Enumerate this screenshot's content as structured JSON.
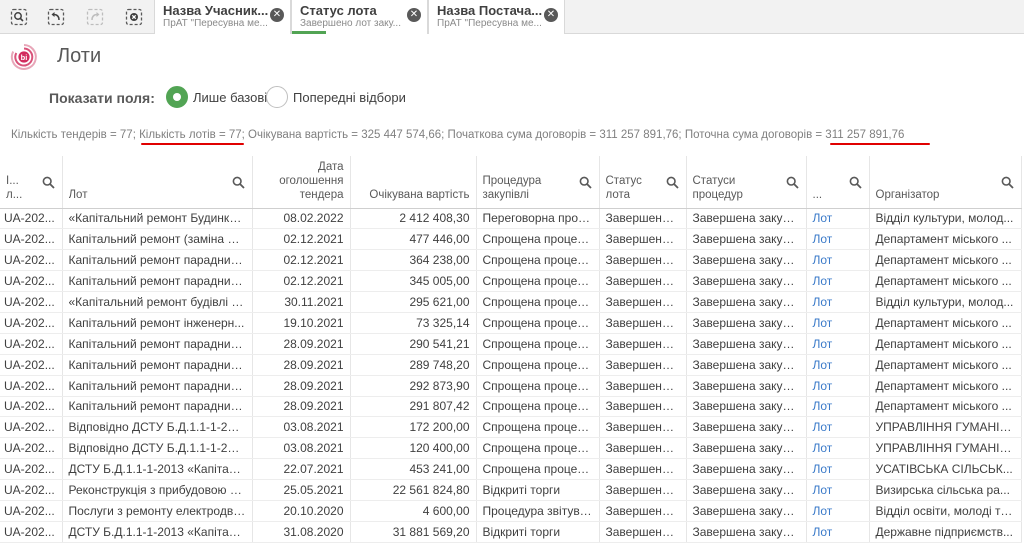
{
  "toolbar": {
    "icons": [
      "smart-search-icon",
      "step-back-icon",
      "step-forward-icon",
      "clear-selections-icon"
    ]
  },
  "selections": [
    {
      "title": "Назва Учасник...",
      "subtitle": "ПрАТ \"Пересувна ме...",
      "active": false
    },
    {
      "title": "Статус лота",
      "subtitle": "Завершено лот заку...",
      "active": true
    },
    {
      "title": "Назва Постача...",
      "subtitle": "ПрАТ \"Пересувна ме...",
      "active": false
    }
  ],
  "close_glyph": "✕",
  "colors": {
    "accent": "#52a454",
    "link": "#3a7ac9",
    "highlight": "#e00000"
  },
  "page": {
    "title": "Лоти"
  },
  "show_fields": {
    "label": "Показати поля:",
    "options": [
      {
        "label": "Лише базові",
        "selected": true
      },
      {
        "label": "Попередні відбори",
        "selected": false
      }
    ]
  },
  "kpi": {
    "part1": "Кількість тендерів = 77; ",
    "part2": "Кількість лотів = 77",
    "part3": "; Очікувана вартість = 325 447 574,66; Початкова сума договорів = 311 257 891,76; Поточна сума договорів ",
    "part4": "= 311 257 891,76"
  },
  "table": {
    "headers": [
      {
        "label": "І... л...",
        "search": true
      },
      {
        "label": "Лот",
        "search": true
      },
      {
        "label": "Дата оголошення тендера",
        "search": false
      },
      {
        "label": "Очікувана вартість",
        "search": false
      },
      {
        "label": "Процедура закупівлі",
        "search": true
      },
      {
        "label": "Статус лота",
        "search": true
      },
      {
        "label": "Статуси процедур",
        "search": true
      },
      {
        "label": "...",
        "search": true
      },
      {
        "label": "Організатор",
        "search": true
      }
    ],
    "rows": [
      [
        "UA-202...",
        "«Капітальний ремонт Будинку ...",
        "08.02.2022",
        "2 412 408,30",
        "Переговорна проц...",
        "Завершено ...",
        "Завершена закупі...",
        "Лот",
        "Відділ культури, молод..."
      ],
      [
        "UA-202...",
        "Капітальний ремонт (заміна ві...",
        "02.12.2021",
        "477 446,00",
        "Спрощена процед...",
        "Завершено ...",
        "Завершена закупі...",
        "Лот",
        "Департамент міського ..."
      ],
      [
        "UA-202...",
        "Капітальний ремонт парадних ...",
        "02.12.2021",
        "364 238,00",
        "Спрощена процед...",
        "Завершено ...",
        "Завершена закупі...",
        "Лот",
        "Департамент міського ..."
      ],
      [
        "UA-202...",
        "Капітальний ремонт парадних ...",
        "02.12.2021",
        "345 005,00",
        "Спрощена процед...",
        "Завершено ...",
        "Завершена закупі...",
        "Лот",
        "Департамент міського ..."
      ],
      [
        "UA-202...",
        "«Капітальний ремонт будівлі Б...",
        "30.11.2021",
        "295 621,00",
        "Спрощена процед...",
        "Завершено ...",
        "Завершена закупі...",
        "Лот",
        "Відділ культури, молод..."
      ],
      [
        "UA-202...",
        "Капітальний ремонт інженерн...",
        "19.10.2021",
        "73 325,14",
        "Спрощена процед...",
        "Завершено ...",
        "Завершена закупі...",
        "Лот",
        "Департамент міського ..."
      ],
      [
        "UA-202...",
        "Капітальний ремонт парадних ...",
        "28.09.2021",
        "290 541,21",
        "Спрощена процед...",
        "Завершено ...",
        "Завершена закупі...",
        "Лот",
        "Департамент міського ..."
      ],
      [
        "UA-202...",
        "Капітальний ремонт парадних ...",
        "28.09.2021",
        "289 748,20",
        "Спрощена процед...",
        "Завершено ...",
        "Завершена закупі...",
        "Лот",
        "Департамент міського ..."
      ],
      [
        "UA-202...",
        "Капітальний ремонт парадних ...",
        "28.09.2021",
        "292 873,90",
        "Спрощена процед...",
        "Завершено ...",
        "Завершена закупі...",
        "Лот",
        "Департамент міського ..."
      ],
      [
        "UA-202...",
        "Капітальний ремонт парадних ...",
        "28.09.2021",
        "291 807,42",
        "Спрощена процед...",
        "Завершено ...",
        "Завершена закупі...",
        "Лот",
        "Департамент міського ..."
      ],
      [
        "UA-202...",
        "Відповідно ДСТУ Б.Д.1.1-1-201...",
        "03.08.2021",
        "172 200,00",
        "Спрощена процед...",
        "Завершено ...",
        "Завершена закупі...",
        "Лот",
        "УПРАВЛІННЯ ГУМАНІТ..."
      ],
      [
        "UA-202...",
        "Відповідно ДСТУ Б.Д.1.1-1-201...",
        "03.08.2021",
        "120 400,00",
        "Спрощена процед...",
        "Завершено ...",
        "Завершена закупі...",
        "Лот",
        "УПРАВЛІННЯ ГУМАНІТ..."
      ],
      [
        "UA-202...",
        "ДСТУ Б.Д.1.1-1-2013 «Капіталь...",
        "22.07.2021",
        "453 241,00",
        "Спрощена процед...",
        "Завершено ...",
        "Завершена закупі...",
        "Лот",
        "УСАТІВСЬКА СІЛЬСЬК..."
      ],
      [
        "UA-202...",
        "Реконструкція з прибудовою а...",
        "25.05.2021",
        "22 561 824,80",
        "Відкриті торги",
        "Завершено ...",
        "Завершена закупі...",
        "Лот",
        "Визирська сільська ра..."
      ],
      [
        "UA-202...",
        "Послуги з ремонту електродви...",
        "20.10.2020",
        "4 600,00",
        "Процедура звітува...",
        "Завершено ...",
        "Завершена закупі...",
        "Лот",
        "Відділ освіти, молоді та..."
      ],
      [
        "UA-202...",
        "ДСТУ Б.Д.1.1-1-2013 «Капіталь...",
        "31.08.2020",
        "31 881 569,20",
        "Відкриті торги",
        "Завершено ...",
        "Завершена закупі...",
        "Лот",
        "Державне підприємств..."
      ]
    ]
  }
}
